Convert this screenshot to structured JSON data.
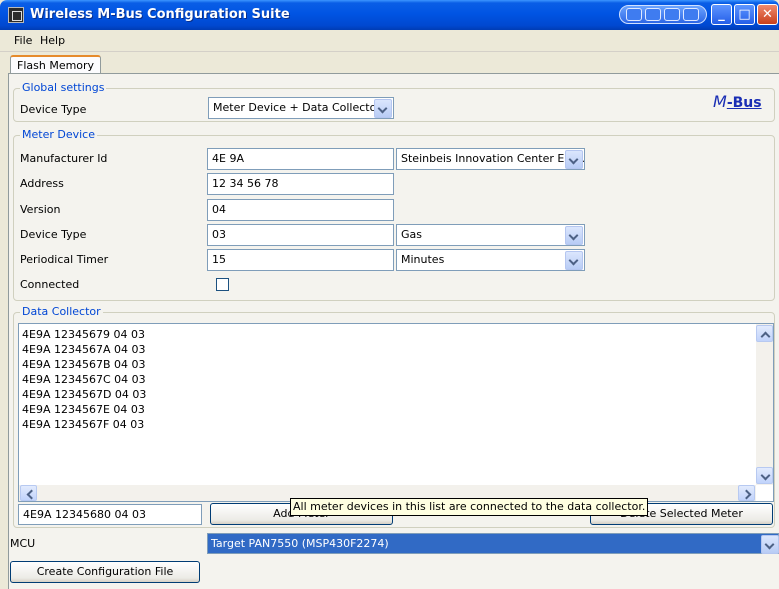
{
  "window": {
    "title": "Wireless M-Bus Configuration Suite"
  },
  "menu": {
    "file": "File",
    "help": "Help"
  },
  "tabs": [
    {
      "label": "Flash Memory"
    }
  ],
  "global_settings": {
    "title": "Global settings",
    "device_type_label": "Device Type",
    "device_type_value": "Meter Device + Data Collector",
    "logo_text_m": "M",
    "logo_text_bus": "-Bus"
  },
  "meter_device": {
    "title": "Meter Device",
    "manufacturer_label": "Manufacturer Id",
    "manufacturer_value": "4E 9A",
    "manufacturer_name": "Steinbeis Innovation Center Em...",
    "address_label": "Address",
    "address_value": "12 34 56 78",
    "version_label": "Version",
    "version_value": "04",
    "device_type_label": "Device Type",
    "device_type_value": "03",
    "device_type_name": "Gas",
    "timer_label": "Periodical Timer",
    "timer_value": "15",
    "timer_unit": "Minutes",
    "connected_label": "Connected",
    "connected_checked": false
  },
  "data_collector": {
    "title": "Data Collector",
    "items": [
      "4E9A 12345679 04 03",
      "4E9A 1234567A 04 03",
      "4E9A 1234567B 04 03",
      "4E9A 1234567C 04 03",
      "4E9A 1234567D 04 03",
      "4E9A 1234567E 04 03",
      "4E9A 1234567F 04 03"
    ],
    "new_entry_value": "4E9A 12345680 04 03",
    "add_button": "Add Meter",
    "delete_button": "Delete Selected Meter",
    "tooltip": "All meter devices in this list are connected to the data collector."
  },
  "mcu": {
    "label": "MCU",
    "value": "Target PAN7550 (MSP430F2274)"
  },
  "create_button": "Create Configuration File"
}
